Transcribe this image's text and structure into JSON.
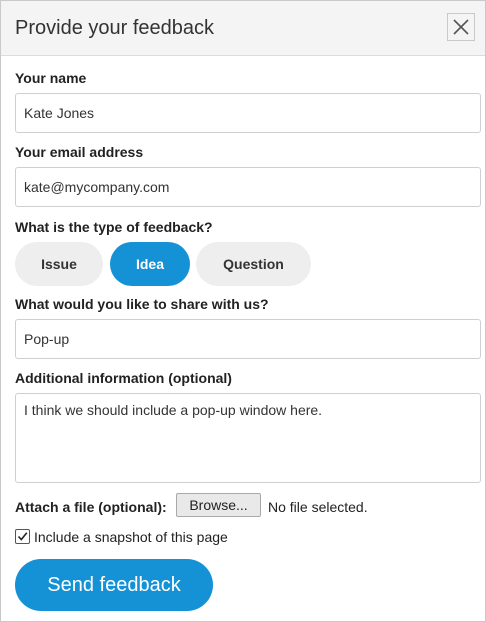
{
  "dialog": {
    "title": "Provide your feedback",
    "close_icon": "close-icon"
  },
  "form": {
    "name": {
      "label": "Your name",
      "value": "Kate Jones"
    },
    "email": {
      "label": "Your email address",
      "value": "kate@mycompany.com"
    },
    "feedback_type": {
      "label": "What is the type of feedback?",
      "options": [
        "Issue",
        "Idea",
        "Question"
      ],
      "selected": "Idea"
    },
    "share": {
      "label": "What would you like to share with us?",
      "value": "Pop-up"
    },
    "additional": {
      "label": "Additional information (optional)",
      "value": "I think we should include a pop-up window here."
    },
    "attachment": {
      "label": "Attach a file (optional):",
      "button_label": "Browse...",
      "status": "No file selected."
    },
    "snapshot": {
      "label": "Include a snapshot of this page",
      "checked": true
    },
    "submit_label": "Send feedback"
  },
  "colors": {
    "accent": "#1592d6",
    "pill_inactive": "#eeeeee",
    "header_bg": "#f4f4f4"
  }
}
